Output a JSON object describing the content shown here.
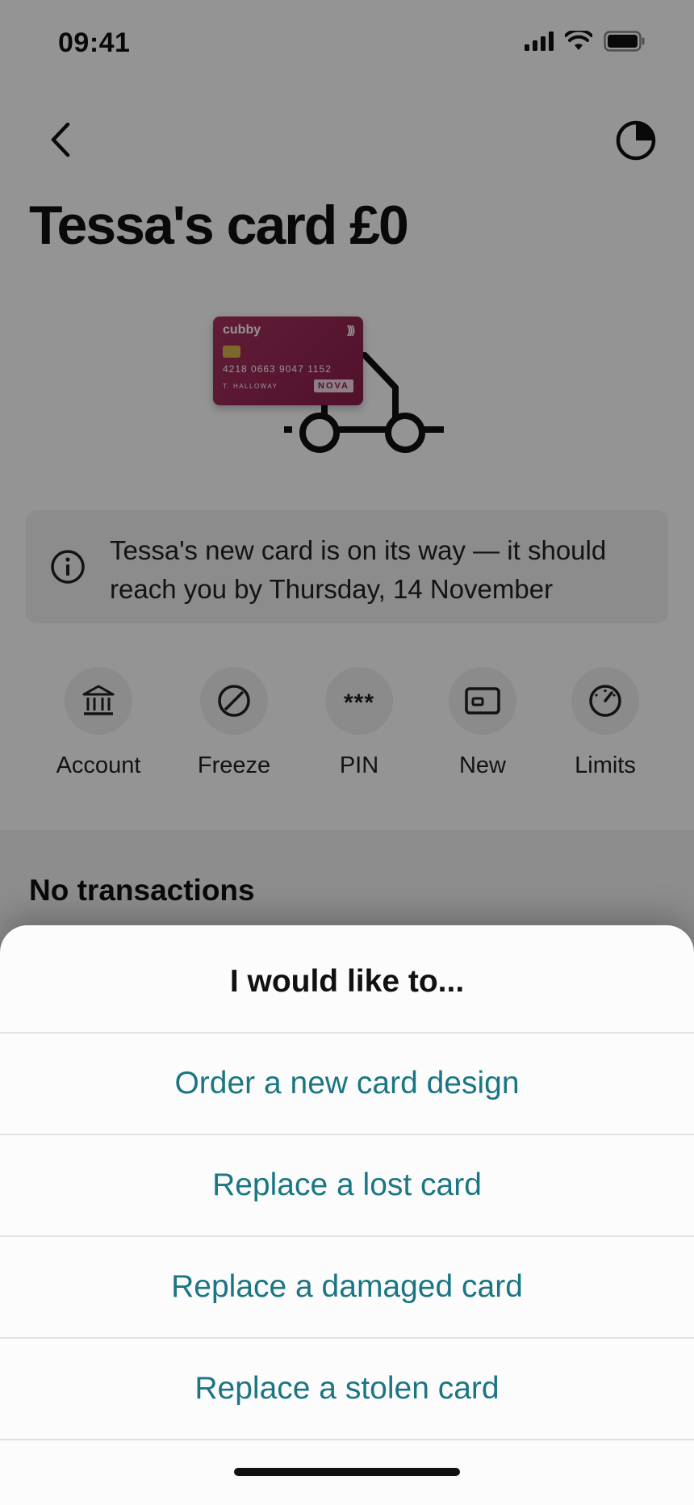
{
  "status_bar": {
    "time": "09:41",
    "icons": [
      "signal-icon",
      "wifi-icon",
      "battery-icon"
    ]
  },
  "nav": {
    "back_icon": "chevron-left-icon",
    "analytics_icon": "pie-chart-icon"
  },
  "page": {
    "title": "Tessa's card £0"
  },
  "card": {
    "brand": "cubby",
    "contactless_glyph": ")))",
    "number": "4218 0663 9047 1152",
    "holder": "T. HALLOWAY",
    "network": "NOVA",
    "color": "#8a1e4c"
  },
  "info_banner": {
    "icon": "info-icon",
    "text": "Tessa's new card is on its way — it should reach you by Thursday, 14 November"
  },
  "actions": [
    {
      "label": "Account",
      "icon": "bank-icon"
    },
    {
      "label": "Freeze",
      "icon": "freeze-icon"
    },
    {
      "label": "PIN",
      "icon": "pin-icon",
      "glyph": "***"
    },
    {
      "label": "New",
      "icon": "new-card-icon"
    },
    {
      "label": "Limits",
      "icon": "gauge-icon"
    }
  ],
  "transactions": {
    "title": "No transactions"
  },
  "sheet": {
    "title": "I would like to...",
    "options": [
      "Order a new card design",
      "Replace a lost card",
      "Replace a damaged card",
      "Replace a stolen card"
    ],
    "accent_color": "#1a7683"
  }
}
